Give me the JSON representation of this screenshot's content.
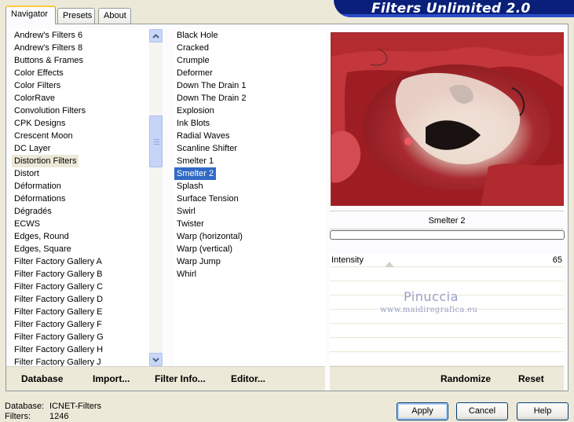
{
  "tabs": [
    {
      "label": "Navigator",
      "active": true
    },
    {
      "label": "Presets",
      "active": false
    },
    {
      "label": "About",
      "active": false
    }
  ],
  "title": "Filters Unlimited 2.0",
  "categories": [
    "Andrew's Filters 6",
    "Andrew's Filters 8",
    "Buttons & Frames",
    "Color Effects",
    "Color Filters",
    "ColorRave",
    "Convolution Filters",
    "CPK Designs",
    "Crescent Moon",
    "DC Layer",
    "Distortion Filters",
    "Distort",
    "Déformation",
    "Déformations",
    "Dégradés",
    "ECWS",
    "Edges, Round",
    "Edges, Square",
    "Filter Factory Gallery A",
    "Filter Factory Gallery B",
    "Filter Factory Gallery C",
    "Filter Factory Gallery D",
    "Filter Factory Gallery E",
    "Filter Factory Gallery F",
    "Filter Factory Gallery G",
    "Filter Factory Gallery H",
    "Filter Factory Gallery J"
  ],
  "selected_category": "Distortion Filters",
  "filters": [
    "Black Hole",
    "Cracked",
    "Crumple",
    "Deformer",
    "Down The Drain 1",
    "Down The Drain 2",
    "Explosion",
    "Ink Blots",
    "Radial Waves",
    "Scanline Shifter",
    "Smelter 1",
    "Smelter 2",
    "Splash",
    "Surface Tension",
    "Swirl",
    "Twister",
    "Warp (horizontal)",
    "Warp (vertical)",
    "Warp Jump",
    "Whirl"
  ],
  "selected_filter": "Smelter 2",
  "left_bar": {
    "database": "Database",
    "import": "Import...",
    "filter_info": "Filter Info...",
    "editor": "Editor..."
  },
  "right_bar": {
    "randomize": "Randomize",
    "reset": "Reset"
  },
  "preview_filter_name": "Smelter 2",
  "progress_fraction": 0,
  "parameters": [
    {
      "label": "Intensity",
      "value": "65"
    }
  ],
  "watermark": {
    "name": "Pinuccia",
    "url": "www.maidiregrafica.eu"
  },
  "status": {
    "database_label": "Database:",
    "database_value": "ICNET-Filters",
    "filters_label": "Filters:",
    "filters_value": "1246"
  },
  "buttons": {
    "apply": "Apply",
    "cancel": "Cancel",
    "help": "Help"
  },
  "colors": {
    "selection_blue": "#316ac5",
    "banner": "#0a1f7a",
    "preview_red": "#c1353a"
  }
}
